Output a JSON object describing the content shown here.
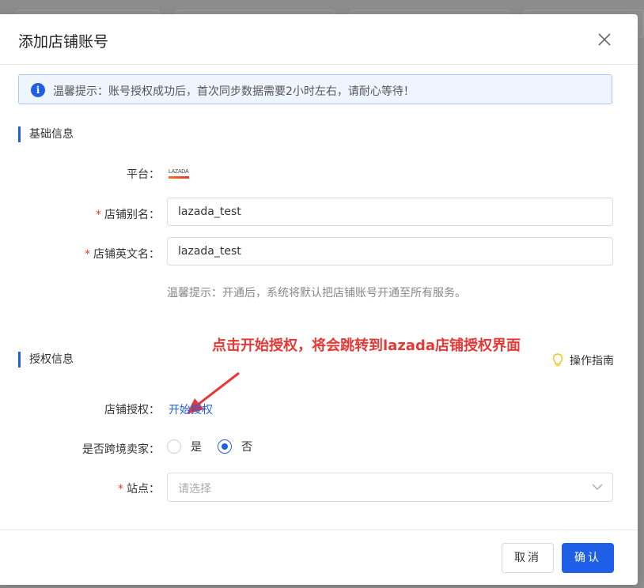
{
  "modal": {
    "title": "添加店铺账号"
  },
  "notice": {
    "text": "温馨提示：账号授权成功后，首次同步数据需要2小时左右，请耐心等待！"
  },
  "basic": {
    "section_title": "基础信息",
    "platform_label": "平台：",
    "platform_logo_text": "LAZADA",
    "alias_label": "店铺别名：",
    "alias_value": "lazada_test",
    "english_name_label": "店铺英文名：",
    "english_name_value": "lazada_test",
    "hint": "温馨提示：开通后，系统将默认把店铺账号开通至所有服务。"
  },
  "annotation": {
    "text": "点击开始授权，将会跳转到lazada店铺授权界面"
  },
  "auth": {
    "section_title": "授权信息",
    "guide_label": "操作指南",
    "auth_label": "店铺授权：",
    "auth_link": "开始授权",
    "cross_border_label": "是否跨境卖家：",
    "option_yes": "是",
    "option_no": "否",
    "selected": "否",
    "site_label": "站点：",
    "site_placeholder": "请选择"
  },
  "footer": {
    "cancel_label": "取消",
    "confirm_label": "确认"
  },
  "colors": {
    "primary": "#1f5fe8",
    "annotation": "#e53935",
    "required": "#e53935"
  }
}
